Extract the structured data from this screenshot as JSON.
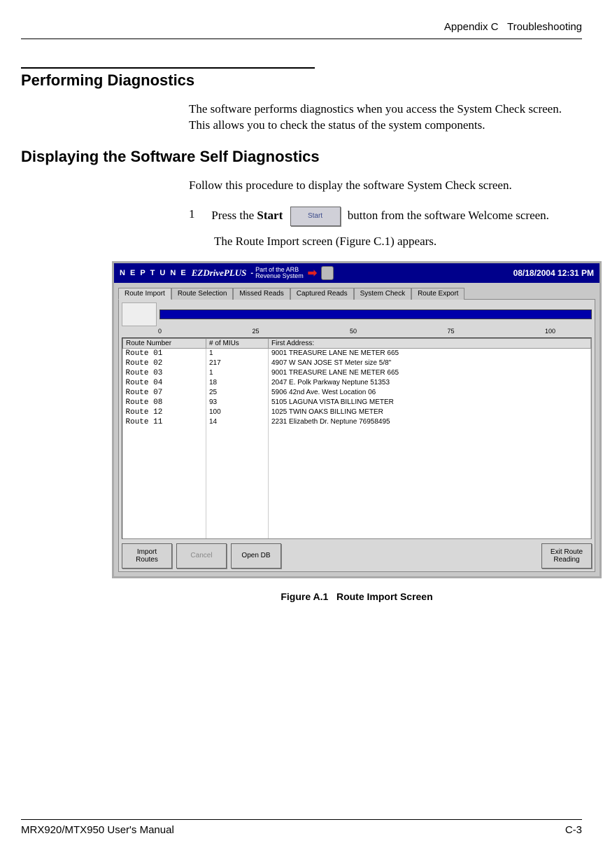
{
  "header": {
    "appendix": "Appendix C",
    "chapter": "Troubleshooting"
  },
  "section": {
    "title": "Performing Diagnostics",
    "intro": "The software performs diagnostics when you access the System Check screen. This allows you to check the status of the system components."
  },
  "subsection": {
    "title": "Displaying the Software Self Diagnostics",
    "intro": "Follow this procedure to display the software System Check screen."
  },
  "step1": {
    "num": "1",
    "pre": "Press the ",
    "bold": "Start",
    "btn_label": "Start",
    "post": " button from the software Welcome screen.",
    "result": "The Route Import screen (Figure C.1) appears."
  },
  "screenshot": {
    "brand": "N E P T U N E",
    "product": "EZDrivePLUS",
    "sub1": "Part of the ARB",
    "sub2": "Revenue System",
    "dash": "-",
    "datetime": "08/18/2004 12:31 PM",
    "tabs": [
      "Route Import",
      "Route Selection",
      "Missed Reads",
      "Captured Reads",
      "System Check",
      "Route Export"
    ],
    "scale": [
      "0",
      "25",
      "50",
      "75",
      "100"
    ],
    "columns": [
      "Route Number",
      "# of MIUs",
      "First Address:"
    ],
    "rows": [
      {
        "route": "Route 01",
        "mius": "1",
        "addr": "9001 TREASURE LANE NE   METER 665"
      },
      {
        "route": "Route 02",
        "mius": "217",
        "addr": "4907 W SAN JOSE ST     Meter size  5/8\""
      },
      {
        "route": "Route 03",
        "mius": "1",
        "addr": "9001 TREASURE LANE NE   METER 665"
      },
      {
        "route": "Route 04",
        "mius": "18",
        "addr": "2047 E. Polk Parkway    Neptune 51353"
      },
      {
        "route": "Route 07",
        "mius": "25",
        "addr": "5906 42nd Ave. West     Location 06"
      },
      {
        "route": "Route 08",
        "mius": "93",
        "addr": "5105 LAGUNA VISTA     BILLING METER"
      },
      {
        "route": "Route 12",
        "mius": "100",
        "addr": "1025 TWIN OAKS        BILLING METER"
      },
      {
        "route": "Route 11",
        "mius": "14",
        "addr": "2231 Elizabeth Dr.      Neptune 76958495"
      }
    ],
    "buttons": {
      "import": "Import\nRoutes",
      "cancel": "Cancel",
      "opendb": "Open DB",
      "exit": "Exit Route\nReading"
    }
  },
  "figure": {
    "label": "Figure A.1",
    "title": "Route Import Screen"
  },
  "footer": {
    "left": "MRX920/MTX950 User's Manual",
    "right": "C-3"
  }
}
